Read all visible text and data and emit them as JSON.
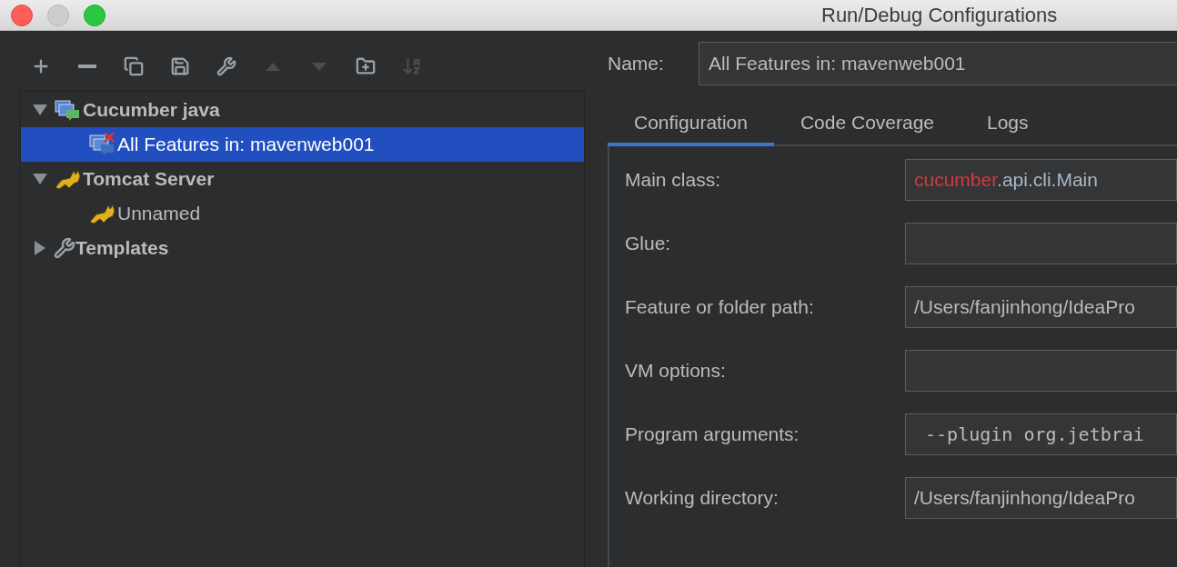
{
  "window": {
    "title": "Run/Debug Configurations"
  },
  "toolbar": [
    {
      "kind": "add",
      "disabled": false
    },
    {
      "kind": "remove",
      "disabled": false
    },
    {
      "kind": "copy",
      "disabled": false
    },
    {
      "kind": "save",
      "disabled": false
    },
    {
      "kind": "edit",
      "disabled": false
    },
    {
      "kind": "up",
      "disabled": true
    },
    {
      "kind": "down",
      "disabled": true
    },
    {
      "kind": "folder",
      "disabled": false
    },
    {
      "kind": "sort",
      "disabled": true
    }
  ],
  "tree": [
    {
      "label": "Cucumber java",
      "kind": "cucumber",
      "expanded": true,
      "selected": false,
      "children": [
        {
          "label": "All Features in: mavenweb001",
          "kind": "cucumber-error",
          "selected": true
        }
      ]
    },
    {
      "label": "Tomcat Server",
      "kind": "tomcat",
      "expanded": true,
      "selected": false,
      "children": [
        {
          "label": "Unnamed",
          "kind": "tomcat",
          "selected": false
        }
      ]
    },
    {
      "label": "Templates",
      "kind": "templates",
      "expanded": false,
      "selected": false
    }
  ],
  "name_field": {
    "label": "Name:",
    "value": "All Features in: mavenweb001"
  },
  "tabs": [
    {
      "label": "Configuration",
      "selected": true
    },
    {
      "label": "Code Coverage",
      "selected": false
    },
    {
      "label": "Logs",
      "selected": false
    }
  ],
  "fields": [
    {
      "label": "Main class:",
      "kind": "class",
      "value": "**cucumber**.api.cli.Main"
    },
    {
      "label": "Glue:",
      "kind": "text"
    },
    {
      "label": "Feature or folder path:",
      "kind": "text",
      "value": "/Users/fanjinhong/IdeaPro"
    },
    {
      "label": "VM options:",
      "kind": "text"
    },
    {
      "label": "Program arguments:",
      "kind": "mono",
      "value": " --plugin org.jetbrai"
    },
    {
      "label": "Working directory:",
      "kind": "text",
      "value": "/Users/fanjinhong/IdeaPro"
    }
  ]
}
